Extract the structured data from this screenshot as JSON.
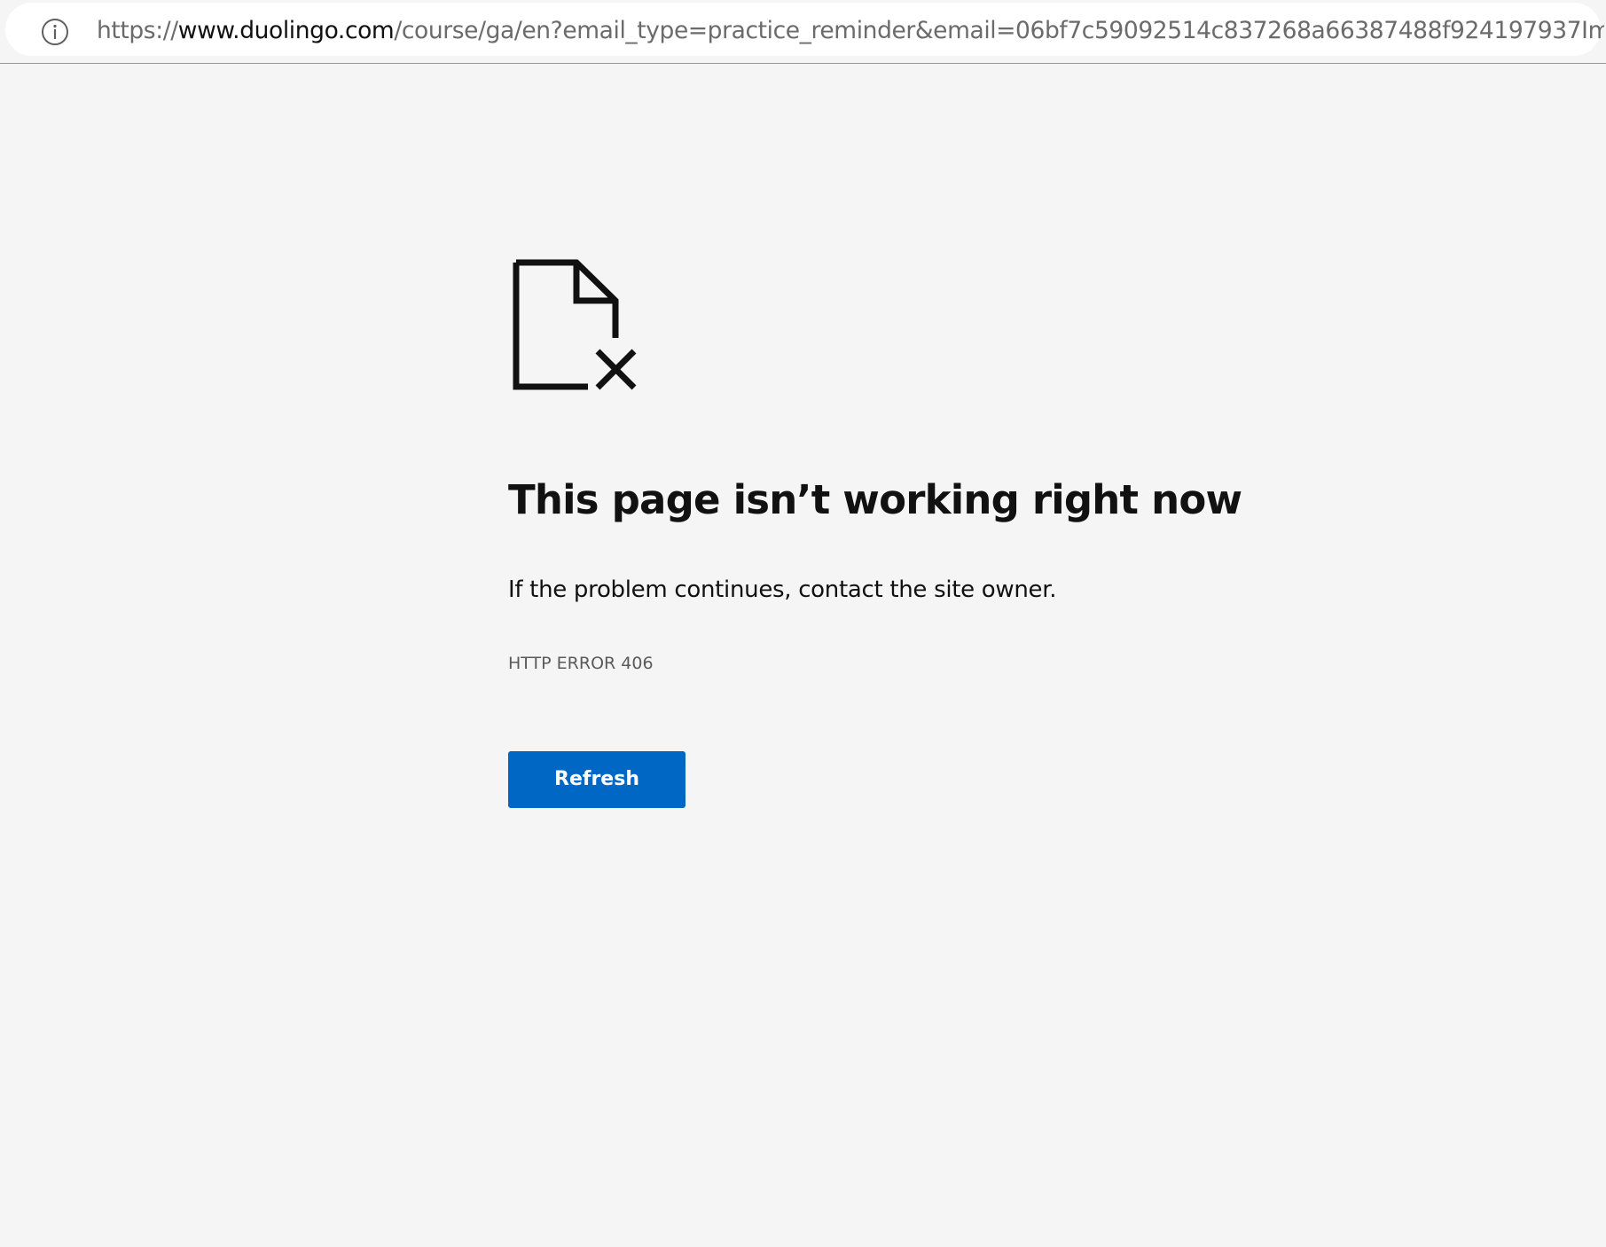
{
  "address_bar": {
    "url_scheme": "https://",
    "url_host": "www.duolingo.com",
    "url_rest": "/course/ga/en?email_type=practice_reminder&email=06bf7c59092514c837268a66387488f924197937Im1jZ2F...",
    "info_icon": "info-circle-icon"
  },
  "error_page": {
    "icon": "broken-document-icon",
    "title": "This page isn’t working right now",
    "message": "If the problem continues, contact the site owner.",
    "error_code": "HTTP ERROR 406",
    "refresh_label": "Refresh"
  },
  "colors": {
    "background": "#f5f5f5",
    "button": "#0067c5",
    "text": "#111111",
    "muted": "#5a5a5a"
  }
}
